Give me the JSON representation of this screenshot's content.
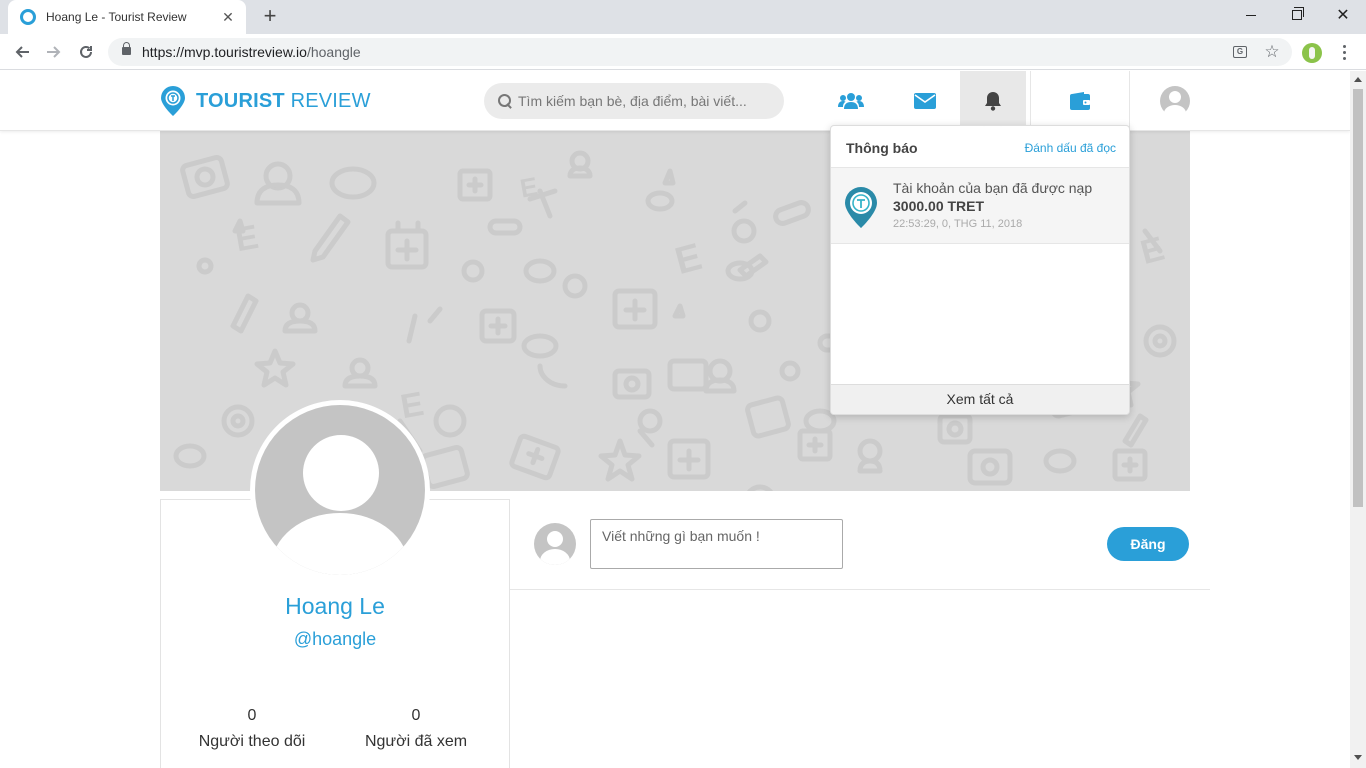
{
  "browser": {
    "tab_title": "Hoang Le - Tourist Review",
    "tab_close": "✕",
    "new_tab": "+",
    "url_host": "https://mvp.touristreview.io",
    "url_path": "/hoangle"
  },
  "site": {
    "logo_bold": "TOURIST",
    "logo_rest": " REVIEW",
    "brand_color": "#2a9fd8",
    "search_placeholder": "Tìm kiếm bạn bè, địa điểm, bài viết..."
  },
  "header_icons": [
    "friends-icon",
    "mail-icon",
    "bell-icon",
    "wallet-icon",
    "avatar-icon"
  ],
  "notifications": {
    "title": "Thông báo",
    "mark_read": "Đánh dấu đã đọc",
    "items": [
      {
        "text": "Tài khoản của bạn đã được nạp",
        "amount": "3000.00 TRET",
        "time": "22:53:29, 0, THG 11, 2018"
      }
    ],
    "view_all": "Xem tất cả"
  },
  "profile": {
    "name": "Hoang Le",
    "handle": "@hoangle",
    "stats": [
      {
        "value": "0",
        "label": "Người theo dõi"
      },
      {
        "value": "0",
        "label": "Người đã xem"
      }
    ]
  },
  "composer": {
    "placeholder": "Viết những gì bạn muốn !",
    "post_label": "Đăng"
  }
}
